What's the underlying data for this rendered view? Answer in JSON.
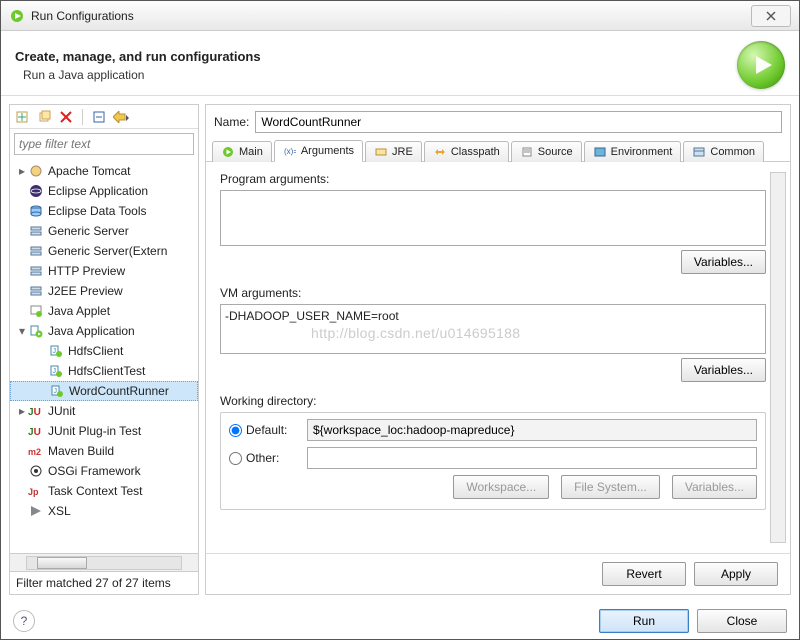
{
  "window": {
    "title": "Run Configurations"
  },
  "header": {
    "title": "Create, manage, and run configurations",
    "subtitle": "Run a Java application"
  },
  "filter": {
    "placeholder": "type filter text"
  },
  "tree": [
    {
      "expand": "collapsed",
      "icon": "tomcat",
      "label": "Apache Tomcat",
      "indent": 0
    },
    {
      "expand": "none",
      "icon": "eclipse",
      "label": "Eclipse Application",
      "indent": 0
    },
    {
      "expand": "none",
      "icon": "datatools",
      "label": "Eclipse Data Tools",
      "indent": 0
    },
    {
      "expand": "none",
      "icon": "server",
      "label": "Generic Server",
      "indent": 0
    },
    {
      "expand": "none",
      "icon": "server",
      "label": "Generic Server(Extern",
      "indent": 0
    },
    {
      "expand": "none",
      "icon": "server",
      "label": "HTTP Preview",
      "indent": 0
    },
    {
      "expand": "none",
      "icon": "server",
      "label": "J2EE Preview",
      "indent": 0
    },
    {
      "expand": "none",
      "icon": "applet",
      "label": "Java Applet",
      "indent": 0
    },
    {
      "expand": "expanded",
      "icon": "javaapp",
      "label": "Java Application",
      "indent": 0
    },
    {
      "expand": "none",
      "icon": "javarun",
      "label": "HdfsClient",
      "indent": 1
    },
    {
      "expand": "none",
      "icon": "javarun",
      "label": "HdfsClientTest",
      "indent": 1
    },
    {
      "expand": "none",
      "icon": "javarun",
      "label": "WordCountRunner",
      "indent": 1,
      "selected": true
    },
    {
      "expand": "collapsed",
      "icon": "junit",
      "label": "JUnit",
      "indent": 0
    },
    {
      "expand": "none",
      "icon": "junit",
      "label": "JUnit Plug-in Test",
      "indent": 0
    },
    {
      "expand": "none",
      "icon": "maven",
      "label": "Maven Build",
      "indent": 0
    },
    {
      "expand": "none",
      "icon": "osgi",
      "label": "OSGi Framework",
      "indent": 0
    },
    {
      "expand": "none",
      "icon": "task",
      "label": "Task Context Test",
      "indent": 0
    },
    {
      "expand": "none",
      "icon": "xsl",
      "label": "XSL",
      "indent": 0
    }
  ],
  "status": "Filter matched 27 of 27 items",
  "name": {
    "label": "Name:",
    "value": "WordCountRunner"
  },
  "tabs": [
    {
      "id": "main",
      "label": "Main",
      "icon": "run-green"
    },
    {
      "id": "arguments",
      "label": "Arguments",
      "icon": "args",
      "active": true
    },
    {
      "id": "jre",
      "label": "JRE",
      "icon": "jre"
    },
    {
      "id": "classpath",
      "label": "Classpath",
      "icon": "classpath"
    },
    {
      "id": "source",
      "label": "Source",
      "icon": "source"
    },
    {
      "id": "environment",
      "label": "Environment",
      "icon": "env"
    },
    {
      "id": "common",
      "label": "Common",
      "icon": "common"
    }
  ],
  "arguments": {
    "program_label": "Program arguments:",
    "program_value": "",
    "vm_label": "VM arguments:",
    "vm_value": "-DHADOOP_USER_NAME=root",
    "variables_btn": "Variables...",
    "wd_label": "Working directory:",
    "default_label": "Default:",
    "default_value": "${workspace_loc:hadoop-mapreduce}",
    "other_label": "Other:",
    "workspace_btn": "Workspace...",
    "filesystem_btn": "File System...",
    "variables_btn2": "Variables..."
  },
  "bottom": {
    "revert": "Revert",
    "apply": "Apply"
  },
  "footer": {
    "run": "Run",
    "close": "Close"
  },
  "watermark": "http://blog.csdn.net/u014695188"
}
